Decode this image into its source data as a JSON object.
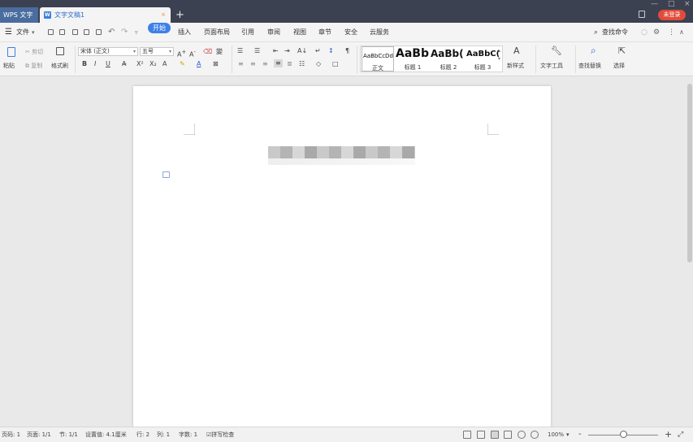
{
  "titlebar": {
    "app_tab": "WPS 文字",
    "doc_tab": "文字文稿1",
    "close_symbol": "×",
    "new_tab_symbol": "+",
    "minimize_symbol": "—",
    "maximize_symbol": "□",
    "login_label": "未登录"
  },
  "menubar": {
    "file_label": "文件",
    "menu_icon": "hamburger-icon",
    "quick_access_icons": [
      "open-icon",
      "save-icon",
      "print-icon",
      "preview-icon",
      "export-icon",
      "undo-icon",
      "redo-icon",
      "more-icon"
    ],
    "tabs": [
      "开始",
      "插入",
      "页面布局",
      "引用",
      "审阅",
      "视图",
      "章节",
      "安全",
      "云服务"
    ],
    "search_label": "查找命令"
  },
  "ribbon": {
    "paste": "粘贴",
    "cut": "剪切",
    "copy": "复制",
    "format_painter": "格式刷",
    "font_name": "宋体 (正文)",
    "font_size": "五号",
    "styles": [
      {
        "sample": "AaBbCcDd",
        "label": "正文"
      },
      {
        "sample": "AaBb",
        "label": "标题 1"
      },
      {
        "sample": "AaBb(",
        "label": "标题 2"
      },
      {
        "sample": "AaBbC(",
        "label": "标题 3"
      }
    ],
    "new_style": "新样式",
    "text_tools": "文字工具",
    "find_replace": "查找替换",
    "select": "选择"
  },
  "statusbar": {
    "page_num": "页码: 1",
    "page_count": "页面: 1/1",
    "section": "节: 1/1",
    "position": "设置值: 4.1厘米",
    "line": "行: 2",
    "column": "列: 1",
    "word_count": "字数: 1",
    "spell_check": "拼写检查",
    "zoom": "100%",
    "zoom_minus": "-",
    "zoom_plus": "+"
  },
  "colors": {
    "titlebar": "#3b4150",
    "accent": "#3f80e8",
    "login": "#e24b3b"
  }
}
